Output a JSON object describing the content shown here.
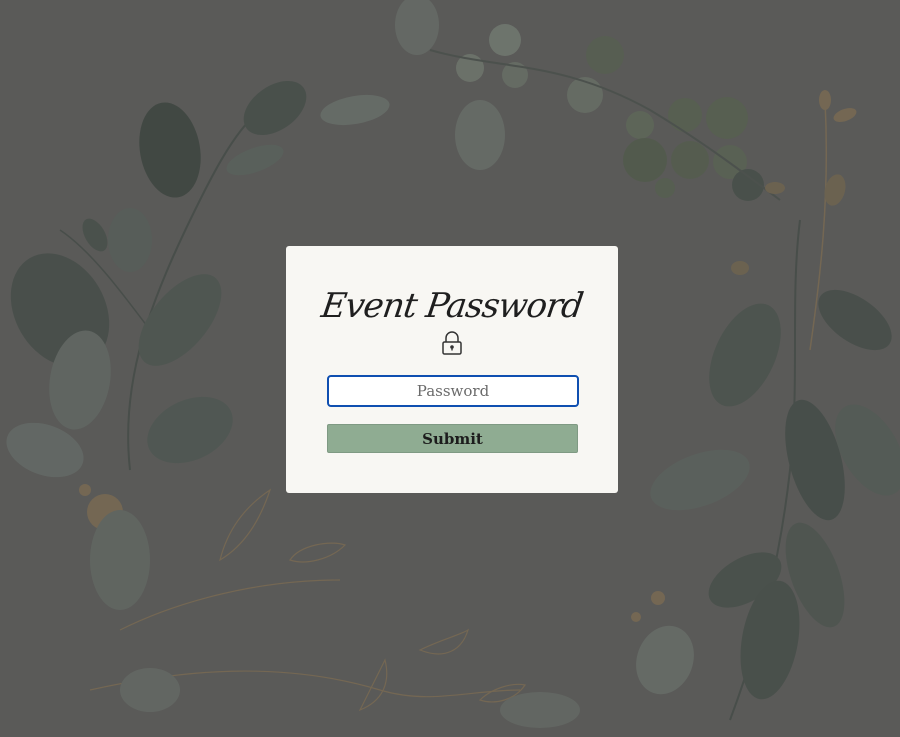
{
  "dialog": {
    "title": "Event Password",
    "lock_icon": "lock-icon",
    "password_placeholder": "Password",
    "password_value": "",
    "submit_label": "Submit"
  },
  "theme": {
    "overlay": "#5a5a58",
    "card": "#f8f7f3",
    "input_focus_border": "#0f4fb0",
    "button_fill": "#8fac92",
    "foliage": "#6f7d70",
    "gold_accent": "#8a7350"
  }
}
